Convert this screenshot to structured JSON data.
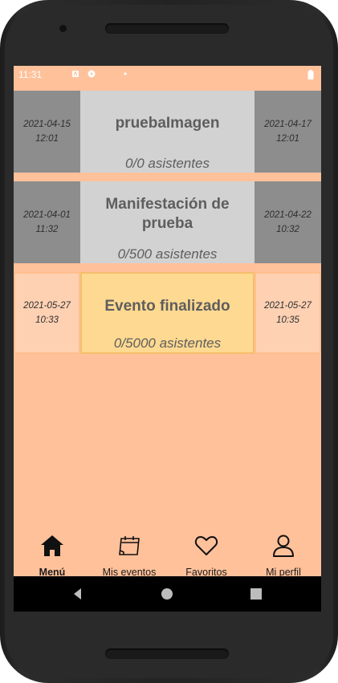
{
  "status_bar": {
    "time": "11:31"
  },
  "events": [
    {
      "start": "2021-04-15\n12:01",
      "title": "pruebaImagen",
      "attendees": "0/0 asistentes",
      "end": "2021-04-17\n12:01"
    },
    {
      "start": "2021-04-01\n11:32",
      "title": "Manifestación de prueba",
      "attendees": "0/500 asistentes",
      "end": "2021-04-22\n10:32"
    },
    {
      "start": "2021-05-27\n10:33",
      "title": "Evento finalizado",
      "attendees": "0/5000 asistentes",
      "end": "2021-05-27\n10:35"
    }
  ],
  "bottom_nav": [
    {
      "label": "Menú",
      "icon": "home-icon",
      "active": true
    },
    {
      "label": "Mis eventos",
      "icon": "calendar-icon",
      "active": false
    },
    {
      "label": "Favoritos",
      "icon": "heart-icon",
      "active": false
    },
    {
      "label": "Mi perfil",
      "icon": "user-icon",
      "active": false
    }
  ],
  "colors": {
    "background": "#ffc19a",
    "finished_event": "#fed991",
    "past_event_dates": "#8d8d8d",
    "past_event_center": "#d2d2d2"
  }
}
